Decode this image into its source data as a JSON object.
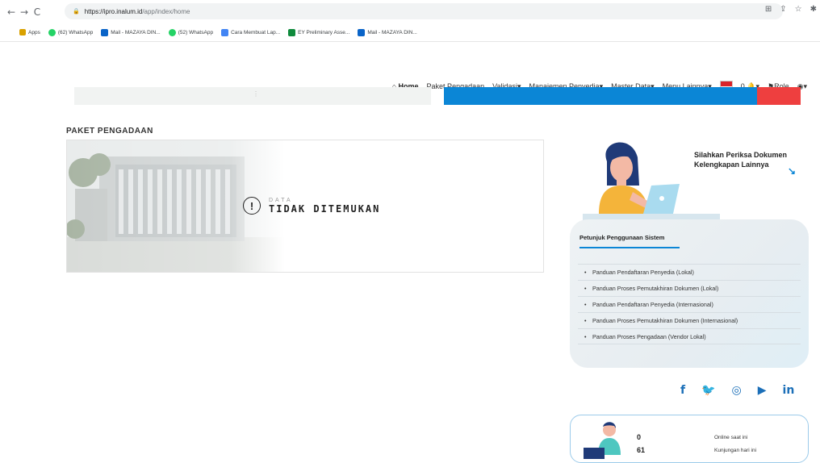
{
  "browser": {
    "url_host": "https://ipro.inalum.id",
    "url_path": "/app/index/home",
    "bookmarks": [
      {
        "label": "Apps",
        "icon": "apps-grid-icon"
      },
      {
        "label": "(62) WhatsApp",
        "icon": "whatsapp-icon"
      },
      {
        "label": "Mail - MAZAYA DIN...",
        "icon": "outlook-icon"
      },
      {
        "label": "(52) WhatsApp",
        "icon": "whatsapp-icon"
      },
      {
        "label": "Cara Membuat Lap...",
        "icon": "google-docs-icon"
      },
      {
        "label": "EY Preliminary Asse...",
        "icon": "excel-icon"
      },
      {
        "label": "Mail - MAZAYA DIN...",
        "icon": "outlook-icon"
      }
    ]
  },
  "nav": {
    "home": "Home",
    "items": [
      "Paket Pengadaan",
      "Validasi",
      "Manajemen Penyedia",
      "Master Data",
      "Menu Lainnya"
    ],
    "notif_count": "0",
    "role": "Role"
  },
  "main": {
    "section_title": "PAKET PENGADAAN",
    "empty_small": "DATA",
    "empty_big": "TIDAK DITEMUKAN"
  },
  "side": {
    "hint_line1": "Silahkan Periksa Dokumen",
    "hint_line2": "Kelengkapan Lainnya",
    "guide_title": "Petunjuk Penggunaan Sistem",
    "guides": [
      "Panduan Pendaftaran Penyedia (Lokal)",
      "Panduan Proses Pemutakhiran Dokumen (Lokal)",
      "Panduan Pendaftaran Penyedia (Internasional)",
      "Panduan Proses Pemutakhiran Dokumen (Internasional)",
      "Panduan Proses Pengadaan (Vendor Lokal)"
    ],
    "stats": [
      {
        "value": "0",
        "label": "Online saat ini"
      },
      {
        "value": "61",
        "label": "Kunjungan hari ini"
      }
    ]
  },
  "colors": {
    "accent_blue": "#0b86d6",
    "accent_red": "#ee3f3f",
    "social_blue": "#1b6fb8"
  }
}
